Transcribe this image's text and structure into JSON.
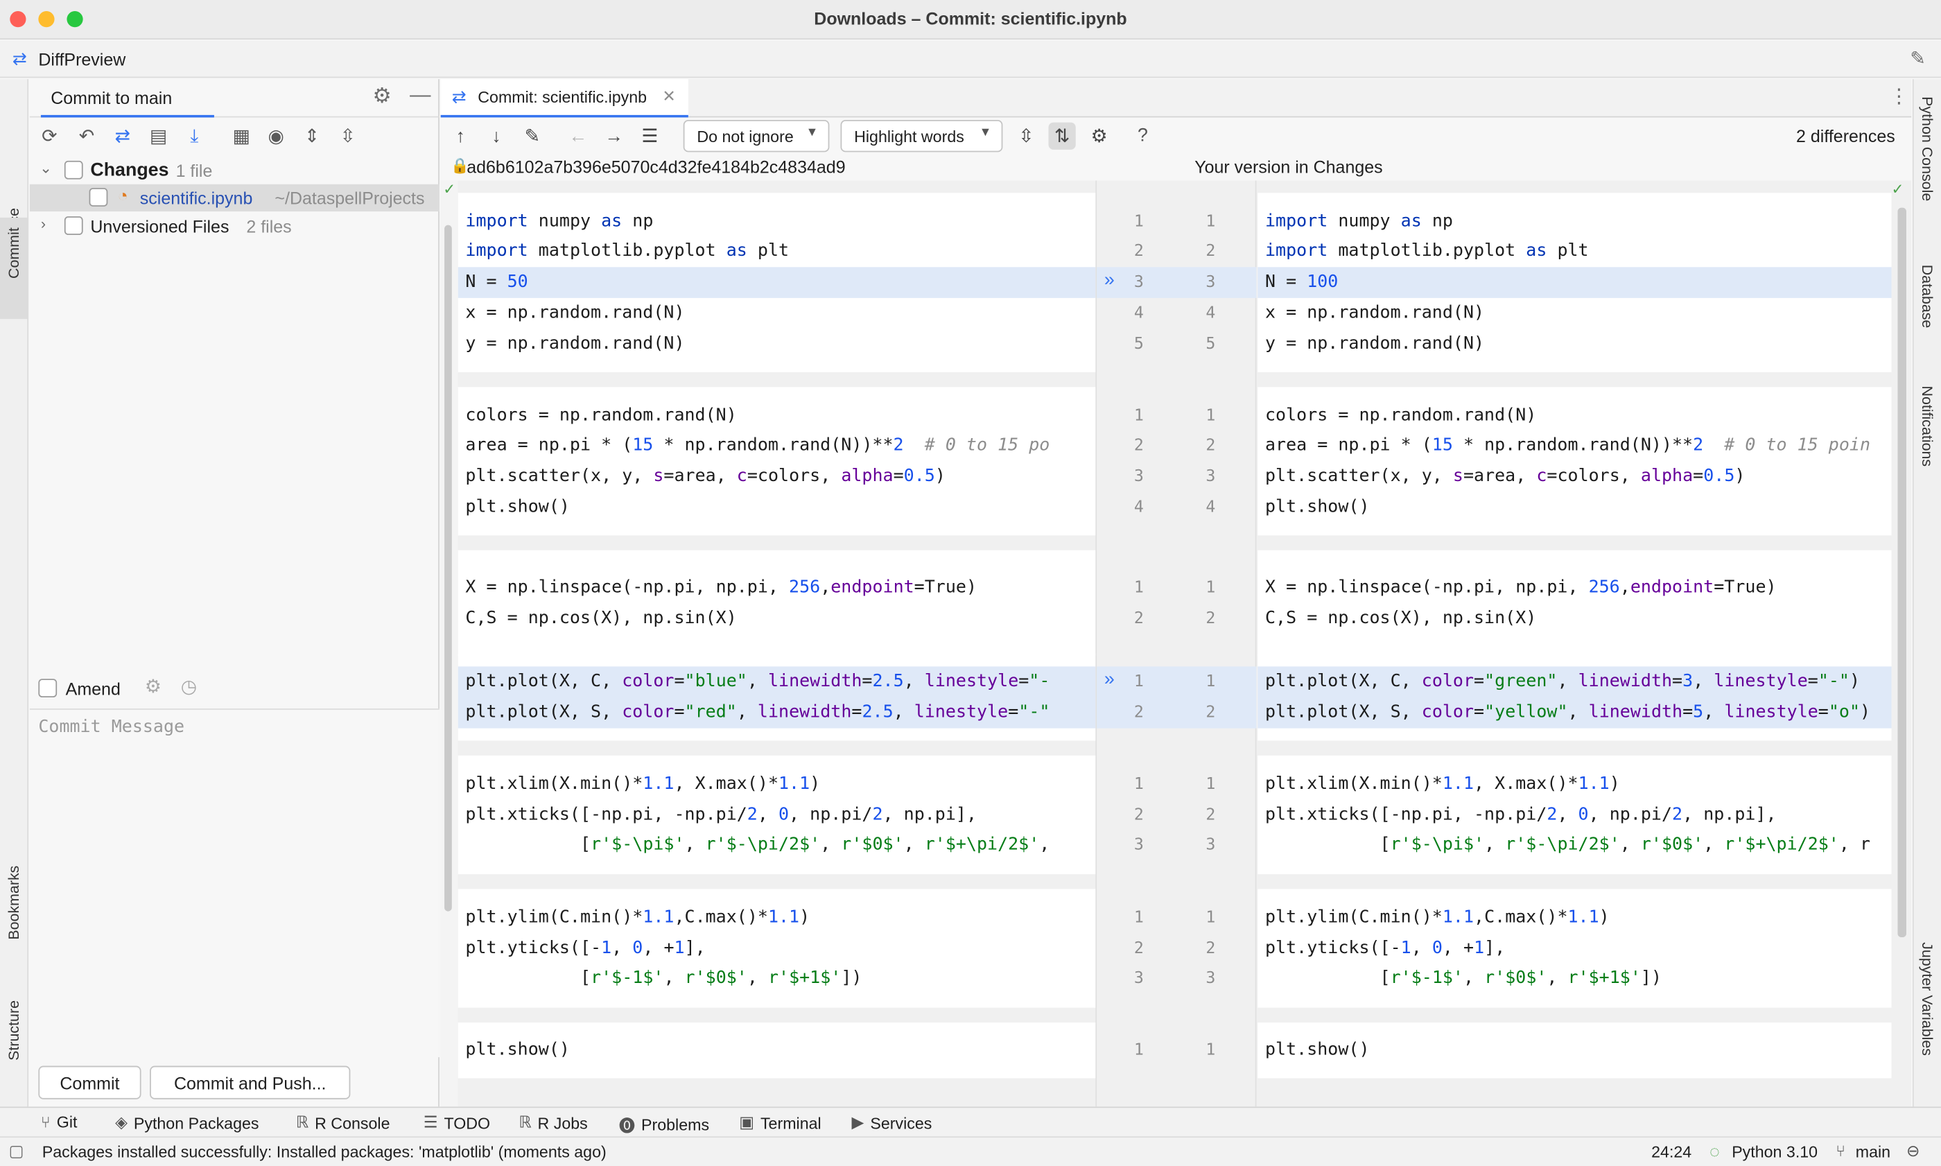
{
  "window": {
    "title": "Downloads – Commit: scientific.ipynb"
  },
  "project": {
    "name": "DiffPreview"
  },
  "left_strip": {
    "workspace": "Workspace",
    "commit": "Commit",
    "bookmarks": "Bookmarks",
    "structure": "Structure"
  },
  "right_strip": {
    "python_console": "Python Console",
    "database": "Database",
    "notifications": "Notifications",
    "jupyter_variables": "Jupyter Variables"
  },
  "commit_panel": {
    "tab_label": "Commit to main",
    "changes_label": "Changes",
    "changes_count": "1 file",
    "file_name": "scientific.ipynb",
    "file_path": "~/DataspellProjects",
    "unversioned_label": "Unversioned Files",
    "unversioned_count": "2 files",
    "amend_label": "Amend",
    "message_placeholder": "Commit Message",
    "commit_button": "Commit",
    "commit_push_button": "Commit and Push..."
  },
  "editor": {
    "tab_label": "Commit: scientific.ipynb",
    "ignore_dropdown": "Do not ignore",
    "highlight_dropdown": "Highlight words",
    "help_label": "?",
    "differences": "2 differences",
    "left_title": "ad6b6102a7b396e5070c4d32fe4184b2c4834ad9",
    "right_title": "Your version in Changes"
  },
  "diff": {
    "left": {
      "c1": [
        "import numpy as np",
        "import matplotlib.pyplot as plt",
        "N = 50",
        "x = np.random.rand(N)",
        "y = np.random.rand(N)"
      ],
      "c2": [
        "colors = np.random.rand(N)",
        "area = np.pi * (15 * np.random.rand(N))**2  # 0 to 15 po",
        "plt.scatter(x, y, s=area, c=colors, alpha=0.5)",
        "plt.show()"
      ],
      "c3": [
        "X = np.linspace(-np.pi, np.pi, 256,endpoint=True)",
        "C,S = np.cos(X), np.sin(X)"
      ],
      "c4": [
        "plt.plot(X, C, color=\"blue\", linewidth=2.5, linestyle=\"-",
        "plt.plot(X, S, color=\"red\", linewidth=2.5, linestyle=\"-\""
      ],
      "c5": [
        "plt.xlim(X.min()*1.1, X.max()*1.1)",
        "plt.xticks([-np.pi, -np.pi/2, 0, np.pi/2, np.pi],",
        "           [r'$-\\pi$', r'$-\\pi/2$', r'$0$', r'$+\\pi/2$',"
      ],
      "c6": [
        "plt.ylim(C.min()*1.1,C.max()*1.1)",
        "plt.yticks([-1, 0, +1],",
        "           [r'$-1$', r'$0$', r'$+1$'])"
      ],
      "c7": [
        "plt.show()"
      ]
    },
    "right": {
      "c1": [
        "import numpy as np",
        "import matplotlib.pyplot as plt",
        "N = 100",
        "x = np.random.rand(N)",
        "y = np.random.rand(N)"
      ],
      "c2": [
        "colors = np.random.rand(N)",
        "area = np.pi * (15 * np.random.rand(N))**2  # 0 to 15 poin",
        "plt.scatter(x, y, s=area, c=colors, alpha=0.5)",
        "plt.show()"
      ],
      "c3": [
        "X = np.linspace(-np.pi, np.pi, 256,endpoint=True)",
        "C,S = np.cos(X), np.sin(X)"
      ],
      "c4": [
        "plt.plot(X, C, color=\"green\", linewidth=3, linestyle=\"-\")",
        "plt.plot(X, S, color=\"yellow\", linewidth=5, linestyle=\"o\")"
      ],
      "c5": [
        "plt.xlim(X.min()*1.1, X.max()*1.1)",
        "plt.xticks([-np.pi, -np.pi/2, 0, np.pi/2, np.pi],",
        "           [r'$-\\pi$', r'$-\\pi/2$', r'$0$', r'$+\\pi/2$', r"
      ],
      "c6": [
        "plt.ylim(C.min()*1.1,C.max()*1.1)",
        "plt.yticks([-1, 0, +1],",
        "           [r'$-1$', r'$0$', r'$+1$'])"
      ],
      "c7": [
        "plt.show()"
      ]
    },
    "gutter": {
      "c1": [
        "1",
        "2",
        "3",
        "4",
        "5"
      ],
      "c2": [
        "1",
        "2",
        "3",
        "4"
      ],
      "c3": [
        "1",
        "2"
      ],
      "c4": [
        "1",
        "2"
      ],
      "c5": [
        "1",
        "2",
        "3"
      ],
      "c6": [
        "1",
        "2",
        "3"
      ],
      "c7": [
        "1"
      ]
    }
  },
  "bottom_tools": [
    "Git",
    "Python Packages",
    "R Console",
    "TODO",
    "R Jobs",
    "Problems",
    "Terminal",
    "Services"
  ],
  "status": {
    "message": "Packages installed successfully: Installed packages: 'matplotlib' (moments ago)",
    "position": "24:24",
    "interpreter": "Python 3.10",
    "branch": "main"
  },
  "colors": {
    "accent": "#3574f0",
    "keyword": "#0033b3",
    "number": "#1750eb",
    "string": "#067d17",
    "param": "#660099",
    "changed_bg": "#dfe9f8",
    "word_highlight": "#c5d6ee"
  }
}
